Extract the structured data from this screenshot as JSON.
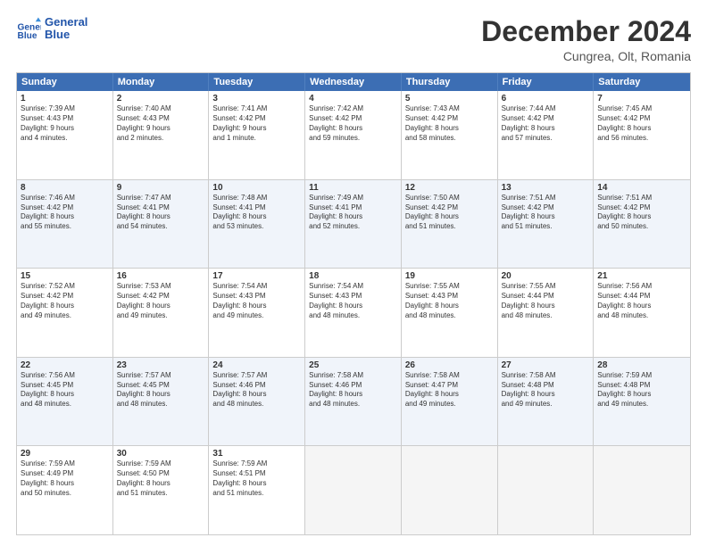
{
  "header": {
    "logo_line1": "General",
    "logo_line2": "Blue",
    "main_title": "December 2024",
    "subtitle": "Cungrea, Olt, Romania"
  },
  "days_of_week": [
    "Sunday",
    "Monday",
    "Tuesday",
    "Wednesday",
    "Thursday",
    "Friday",
    "Saturday"
  ],
  "weeks": [
    [
      {
        "day": "1",
        "text": "Sunrise: 7:39 AM\nSunset: 4:43 PM\nDaylight: 9 hours\nand 4 minutes.",
        "alt": false
      },
      {
        "day": "2",
        "text": "Sunrise: 7:40 AM\nSunset: 4:43 PM\nDaylight: 9 hours\nand 2 minutes.",
        "alt": false
      },
      {
        "day": "3",
        "text": "Sunrise: 7:41 AM\nSunset: 4:42 PM\nDaylight: 9 hours\nand 1 minute.",
        "alt": false
      },
      {
        "day": "4",
        "text": "Sunrise: 7:42 AM\nSunset: 4:42 PM\nDaylight: 8 hours\nand 59 minutes.",
        "alt": false
      },
      {
        "day": "5",
        "text": "Sunrise: 7:43 AM\nSunset: 4:42 PM\nDaylight: 8 hours\nand 58 minutes.",
        "alt": false
      },
      {
        "day": "6",
        "text": "Sunrise: 7:44 AM\nSunset: 4:42 PM\nDaylight: 8 hours\nand 57 minutes.",
        "alt": false
      },
      {
        "day": "7",
        "text": "Sunrise: 7:45 AM\nSunset: 4:42 PM\nDaylight: 8 hours\nand 56 minutes.",
        "alt": false
      }
    ],
    [
      {
        "day": "8",
        "text": "Sunrise: 7:46 AM\nSunset: 4:42 PM\nDaylight: 8 hours\nand 55 minutes.",
        "alt": true
      },
      {
        "day": "9",
        "text": "Sunrise: 7:47 AM\nSunset: 4:41 PM\nDaylight: 8 hours\nand 54 minutes.",
        "alt": true
      },
      {
        "day": "10",
        "text": "Sunrise: 7:48 AM\nSunset: 4:41 PM\nDaylight: 8 hours\nand 53 minutes.",
        "alt": true
      },
      {
        "day": "11",
        "text": "Sunrise: 7:49 AM\nSunset: 4:41 PM\nDaylight: 8 hours\nand 52 minutes.",
        "alt": true
      },
      {
        "day": "12",
        "text": "Sunrise: 7:50 AM\nSunset: 4:42 PM\nDaylight: 8 hours\nand 51 minutes.",
        "alt": true
      },
      {
        "day": "13",
        "text": "Sunrise: 7:51 AM\nSunset: 4:42 PM\nDaylight: 8 hours\nand 51 minutes.",
        "alt": true
      },
      {
        "day": "14",
        "text": "Sunrise: 7:51 AM\nSunset: 4:42 PM\nDaylight: 8 hours\nand 50 minutes.",
        "alt": true
      }
    ],
    [
      {
        "day": "15",
        "text": "Sunrise: 7:52 AM\nSunset: 4:42 PM\nDaylight: 8 hours\nand 49 minutes.",
        "alt": false
      },
      {
        "day": "16",
        "text": "Sunrise: 7:53 AM\nSunset: 4:42 PM\nDaylight: 8 hours\nand 49 minutes.",
        "alt": false
      },
      {
        "day": "17",
        "text": "Sunrise: 7:54 AM\nSunset: 4:43 PM\nDaylight: 8 hours\nand 49 minutes.",
        "alt": false
      },
      {
        "day": "18",
        "text": "Sunrise: 7:54 AM\nSunset: 4:43 PM\nDaylight: 8 hours\nand 48 minutes.",
        "alt": false
      },
      {
        "day": "19",
        "text": "Sunrise: 7:55 AM\nSunset: 4:43 PM\nDaylight: 8 hours\nand 48 minutes.",
        "alt": false
      },
      {
        "day": "20",
        "text": "Sunrise: 7:55 AM\nSunset: 4:44 PM\nDaylight: 8 hours\nand 48 minutes.",
        "alt": false
      },
      {
        "day": "21",
        "text": "Sunrise: 7:56 AM\nSunset: 4:44 PM\nDaylight: 8 hours\nand 48 minutes.",
        "alt": false
      }
    ],
    [
      {
        "day": "22",
        "text": "Sunrise: 7:56 AM\nSunset: 4:45 PM\nDaylight: 8 hours\nand 48 minutes.",
        "alt": true
      },
      {
        "day": "23",
        "text": "Sunrise: 7:57 AM\nSunset: 4:45 PM\nDaylight: 8 hours\nand 48 minutes.",
        "alt": true
      },
      {
        "day": "24",
        "text": "Sunrise: 7:57 AM\nSunset: 4:46 PM\nDaylight: 8 hours\nand 48 minutes.",
        "alt": true
      },
      {
        "day": "25",
        "text": "Sunrise: 7:58 AM\nSunset: 4:46 PM\nDaylight: 8 hours\nand 48 minutes.",
        "alt": true
      },
      {
        "day": "26",
        "text": "Sunrise: 7:58 AM\nSunset: 4:47 PM\nDaylight: 8 hours\nand 49 minutes.",
        "alt": true
      },
      {
        "day": "27",
        "text": "Sunrise: 7:58 AM\nSunset: 4:48 PM\nDaylight: 8 hours\nand 49 minutes.",
        "alt": true
      },
      {
        "day": "28",
        "text": "Sunrise: 7:59 AM\nSunset: 4:48 PM\nDaylight: 8 hours\nand 49 minutes.",
        "alt": true
      }
    ],
    [
      {
        "day": "29",
        "text": "Sunrise: 7:59 AM\nSunset: 4:49 PM\nDaylight: 8 hours\nand 50 minutes.",
        "alt": false
      },
      {
        "day": "30",
        "text": "Sunrise: 7:59 AM\nSunset: 4:50 PM\nDaylight: 8 hours\nand 51 minutes.",
        "alt": false
      },
      {
        "day": "31",
        "text": "Sunrise: 7:59 AM\nSunset: 4:51 PM\nDaylight: 8 hours\nand 51 minutes.",
        "alt": false
      },
      {
        "day": "",
        "text": "",
        "alt": false,
        "empty": true
      },
      {
        "day": "",
        "text": "",
        "alt": false,
        "empty": true
      },
      {
        "day": "",
        "text": "",
        "alt": false,
        "empty": true
      },
      {
        "day": "",
        "text": "",
        "alt": false,
        "empty": true
      }
    ]
  ]
}
